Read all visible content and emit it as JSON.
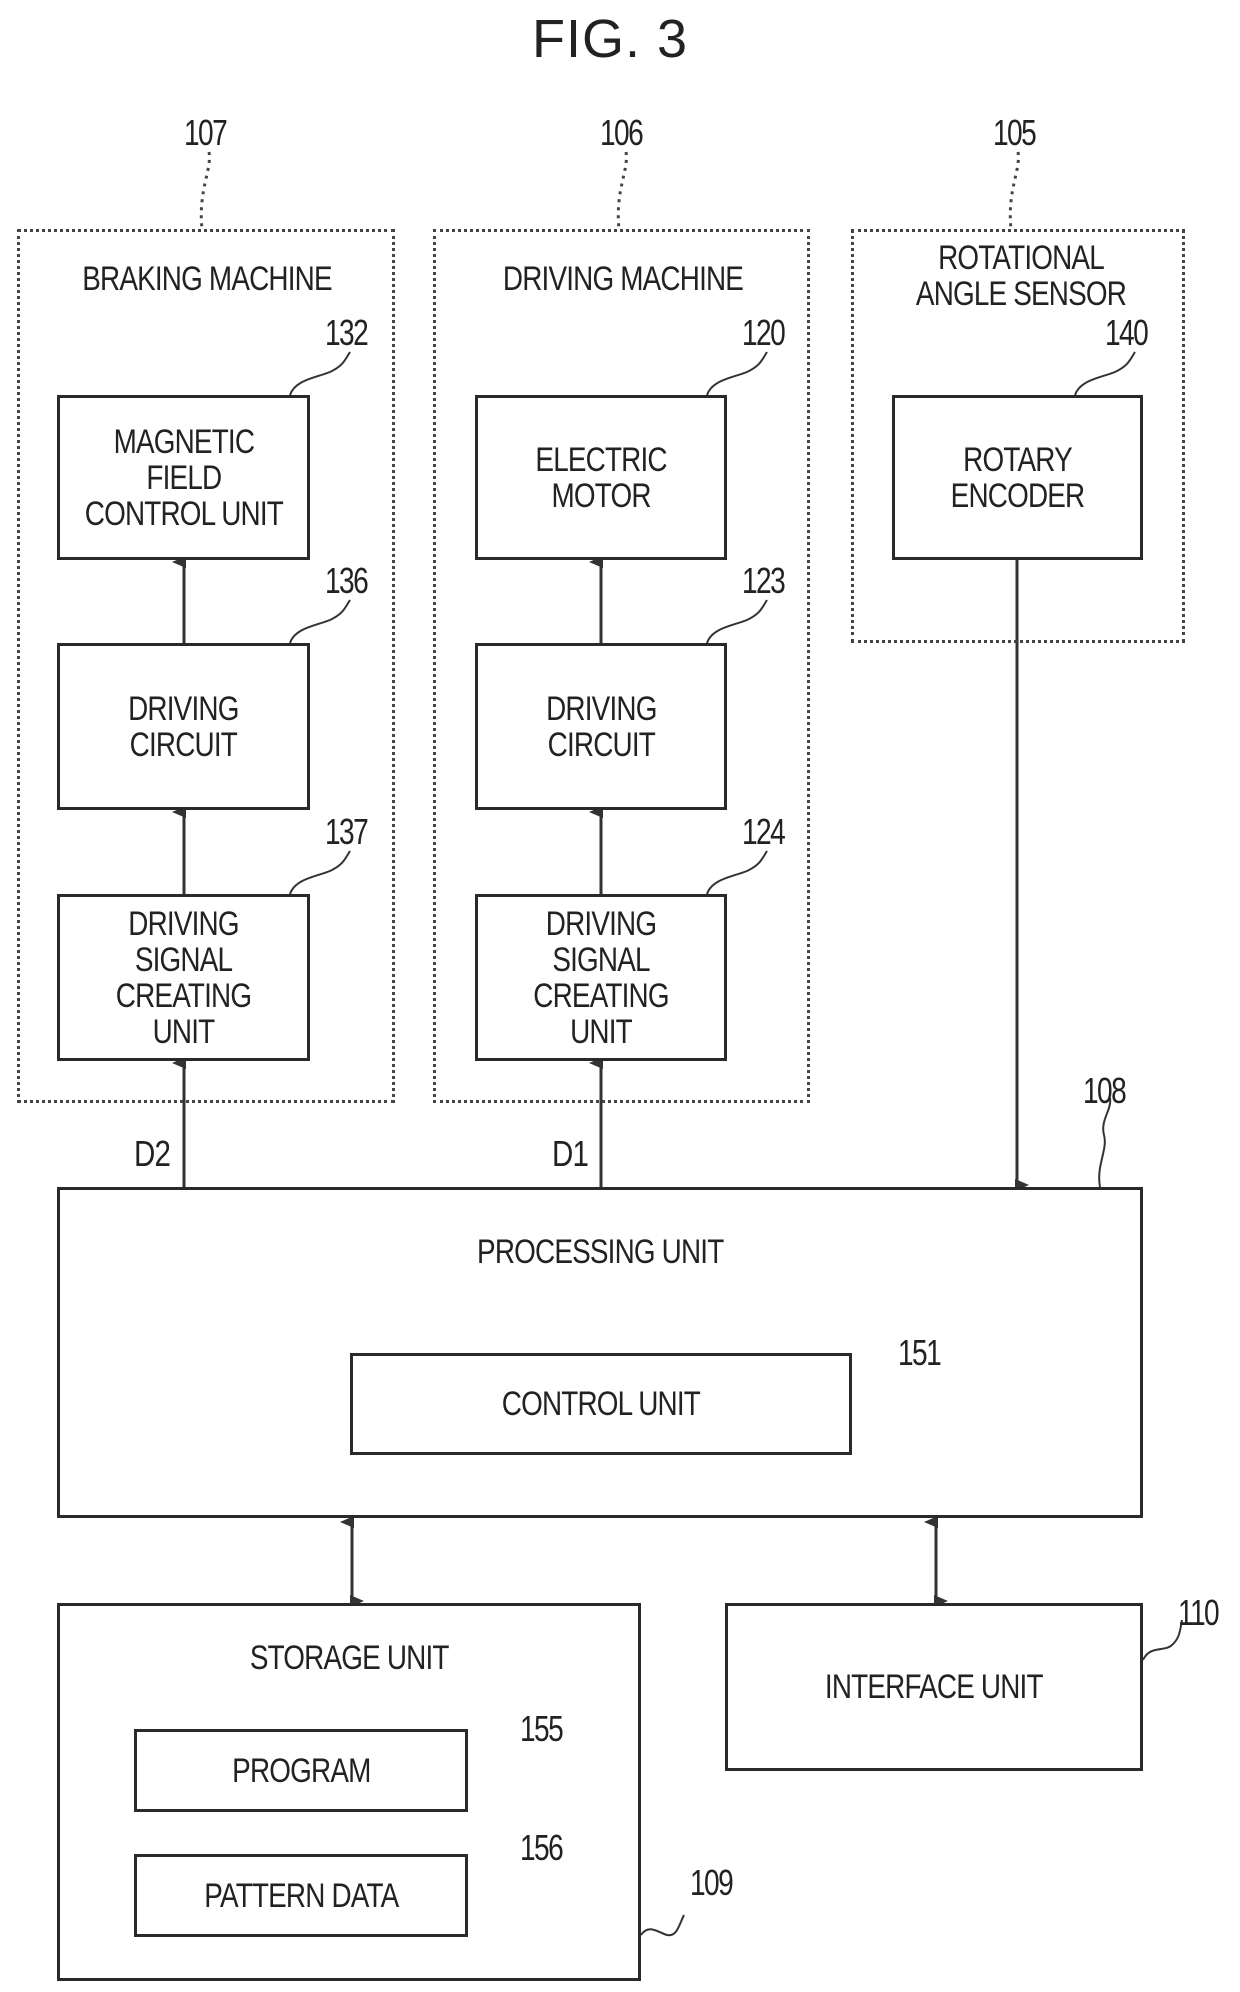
{
  "figure": {
    "title": "FIG. 3",
    "groups": [
      {
        "ref": "107",
        "label": "BRAKING MACHINE"
      },
      {
        "ref": "106",
        "label": "DRIVING MACHINE"
      },
      {
        "ref": "105",
        "label": "ROTATIONAL\nANGLE SENSOR"
      }
    ],
    "blocks": {
      "magnetic_field_control": {
        "ref": "132",
        "label": "MAGNETIC\nFIELD\nCONTROL UNIT"
      },
      "driving_circuit_brake": {
        "ref": "136",
        "label": "DRIVING\nCIRCUIT"
      },
      "driving_signal_brake": {
        "ref": "137",
        "label": "DRIVING\nSIGNAL\nCREATING UNIT"
      },
      "electric_motor": {
        "ref": "120",
        "label": "ELECTRIC\nMOTOR"
      },
      "driving_circuit_drive": {
        "ref": "123",
        "label": "DRIVING\nCIRCUIT"
      },
      "driving_signal_drive": {
        "ref": "124",
        "label": "DRIVING\nSIGNAL\nCREATING UNIT"
      },
      "rotary_encoder": {
        "ref": "140",
        "label": "ROTARY\nENCODER"
      },
      "processing_unit": {
        "ref": "108",
        "label": "PROCESSING UNIT"
      },
      "control_unit": {
        "ref": "151",
        "label": "CONTROL UNIT"
      },
      "storage_unit": {
        "ref": "109",
        "label": "STORAGE UNIT"
      },
      "program": {
        "ref": "155",
        "label": "PROGRAM"
      },
      "pattern_data": {
        "ref": "156",
        "label": "PATTERN DATA"
      },
      "interface_unit": {
        "ref": "110",
        "label": "INTERFACE UNIT"
      }
    },
    "signals": {
      "d1": "D1",
      "d2": "D2"
    }
  }
}
